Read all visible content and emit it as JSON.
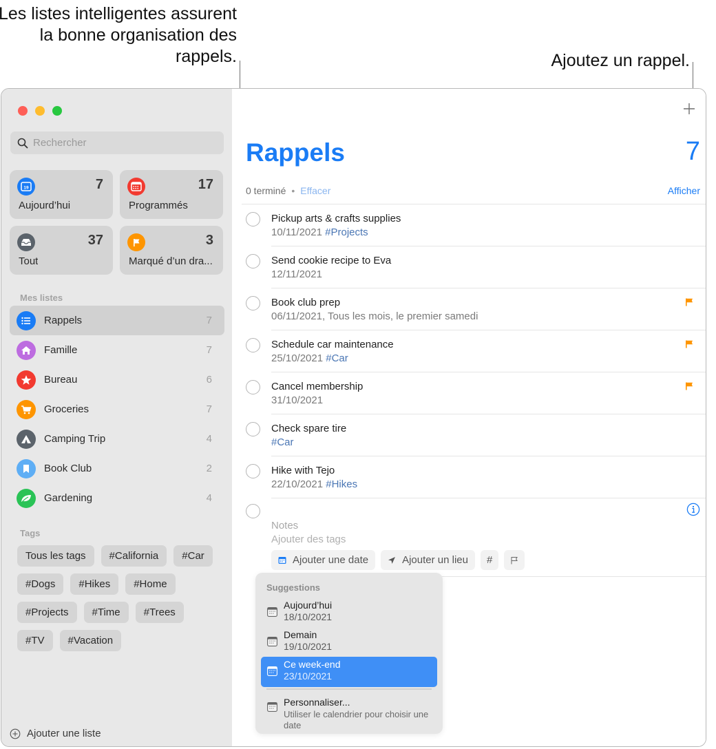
{
  "callouts": {
    "left": "Les listes intelligentes assurent la bonne organisation des rappels.",
    "right": "Ajoutez un rappel."
  },
  "sidebar": {
    "search_placeholder": "Rechercher",
    "smart_lists": [
      {
        "label": "Aujourd’hui",
        "count": "7",
        "icon": "calendar-today-icon",
        "color": "#1a7cf5"
      },
      {
        "label": "Programmés",
        "count": "17",
        "icon": "calendar-icon",
        "color": "#f23a30"
      },
      {
        "label": "Tout",
        "count": "37",
        "icon": "tray-icon",
        "color": "#5b636b"
      },
      {
        "label": "Marqué d’un dra...",
        "count": "3",
        "icon": "flag-icon",
        "color": "#fe9500"
      }
    ],
    "my_lists_label": "Mes listes",
    "lists": [
      {
        "label": "Rappels",
        "count": "7",
        "icon": "list-icon",
        "color": "#1a7cf5",
        "selected": true
      },
      {
        "label": "Famille",
        "count": "7",
        "icon": "house-icon",
        "color": "#bd6ce0"
      },
      {
        "label": "Bureau",
        "count": "6",
        "icon": "star-icon",
        "color": "#f23a30"
      },
      {
        "label": "Groceries",
        "count": "7",
        "icon": "cart-icon",
        "color": "#fe9500"
      },
      {
        "label": "Camping Trip",
        "count": "4",
        "icon": "tent-icon",
        "color": "#5b636b"
      },
      {
        "label": "Book Club",
        "count": "2",
        "icon": "bookmark-icon",
        "color": "#5eaef5"
      },
      {
        "label": "Gardening",
        "count": "4",
        "icon": "leaf-icon",
        "color": "#2ac356"
      }
    ],
    "tags_label": "Tags",
    "tags": [
      "Tous les tags",
      "#California",
      "#Car",
      "#Dogs",
      "#Hikes",
      "#Home",
      "#Projects",
      "#Time",
      "#Trees",
      "#TV",
      "#Vacation"
    ],
    "add_list_label": "Ajouter une liste"
  },
  "main": {
    "title": "Rappels",
    "count": "7",
    "completed": "0 terminé",
    "separator": "•",
    "clear_label": "Effacer",
    "show_label": "Afficher",
    "accent": "#1a7cf5",
    "flag_color": "#fe9500",
    "reminders": [
      {
        "title": "Pickup arts & crafts supplies",
        "date": "10/11/2021",
        "tag": "#Projects",
        "flagged": false
      },
      {
        "title": "Send cookie recipe to Eva",
        "date": "12/11/2021",
        "tag": "",
        "flagged": false
      },
      {
        "title": "Book club prep",
        "date": "06/11/2021, Tous les mois, le premier samedi",
        "tag": "",
        "flagged": true
      },
      {
        "title": "Schedule car maintenance",
        "date": "25/10/2021",
        "tag": "#Car",
        "flagged": true
      },
      {
        "title": "Cancel membership",
        "date": "31/10/2021",
        "tag": "",
        "flagged": true
      },
      {
        "title": "Check spare tire",
        "date": "",
        "tag": "#Car",
        "flagged": false
      },
      {
        "title": "Hike with Tejo",
        "date": "22/10/2021",
        "tag": "#Hikes",
        "flagged": false
      }
    ],
    "new_reminder": {
      "notes_placeholder": "Notes",
      "tags_placeholder": "Ajouter des tags",
      "add_date_label": "Ajouter une date",
      "add_location_label": "Ajouter un lieu",
      "tag_button": "#"
    },
    "suggestions": {
      "title": "Suggestions",
      "items": [
        {
          "label": "Aujourd’hui",
          "date": "18/10/2021",
          "selected": false
        },
        {
          "label": "Demain",
          "date": "19/10/2021",
          "selected": false
        },
        {
          "label": "Ce week-end",
          "date": "23/10/2021",
          "selected": true
        }
      ],
      "custom": {
        "label": "Personnaliser...",
        "description": "Utiliser le calendrier pour choisir une date"
      }
    }
  }
}
